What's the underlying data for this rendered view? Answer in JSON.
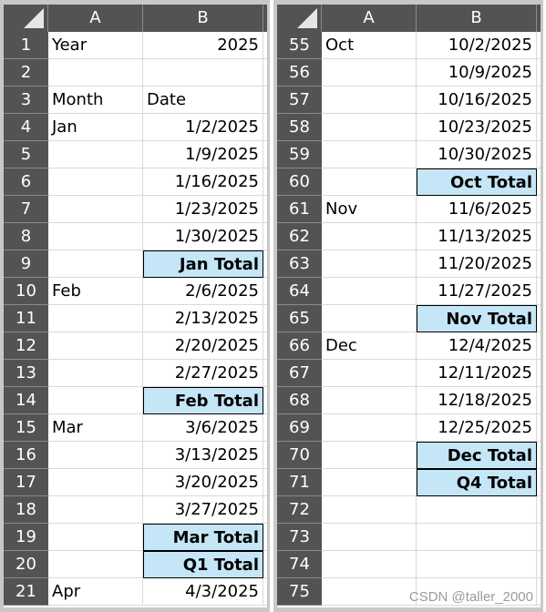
{
  "columns": [
    "A",
    "B"
  ],
  "colors": {
    "header_bg": "#535353",
    "total_fill": "#c5e6f6"
  },
  "left": [
    {
      "n": "1",
      "a": "Year",
      "b": "2025"
    },
    {
      "n": "2",
      "a": "",
      "b": ""
    },
    {
      "n": "3",
      "a": "Month",
      "b": "Date",
      "bl": true
    },
    {
      "n": "4",
      "a": "Jan",
      "b": "1/2/2025"
    },
    {
      "n": "5",
      "a": "",
      "b": "1/9/2025"
    },
    {
      "n": "6",
      "a": "",
      "b": "1/16/2025"
    },
    {
      "n": "7",
      "a": "",
      "b": "1/23/2025"
    },
    {
      "n": "8",
      "a": "",
      "b": "1/30/2025"
    },
    {
      "n": "9",
      "a": "",
      "b": "Jan Total",
      "t": true
    },
    {
      "n": "10",
      "a": "Feb",
      "b": "2/6/2025"
    },
    {
      "n": "11",
      "a": "",
      "b": "2/13/2025"
    },
    {
      "n": "12",
      "a": "",
      "b": "2/20/2025"
    },
    {
      "n": "13",
      "a": "",
      "b": "2/27/2025"
    },
    {
      "n": "14",
      "a": "",
      "b": "Feb Total",
      "t": true
    },
    {
      "n": "15",
      "a": "Mar",
      "b": "3/6/2025"
    },
    {
      "n": "16",
      "a": "",
      "b": "3/13/2025"
    },
    {
      "n": "17",
      "a": "",
      "b": "3/20/2025"
    },
    {
      "n": "18",
      "a": "",
      "b": "3/27/2025"
    },
    {
      "n": "19",
      "a": "",
      "b": "Mar Total",
      "t": true
    },
    {
      "n": "20",
      "a": "",
      "b": "Q1 Total",
      "t": true
    },
    {
      "n": "21",
      "a": "Apr",
      "b": "4/3/2025"
    }
  ],
  "right": [
    {
      "n": "55",
      "a": "Oct",
      "b": "10/2/2025"
    },
    {
      "n": "56",
      "a": "",
      "b": "10/9/2025"
    },
    {
      "n": "57",
      "a": "",
      "b": "10/16/2025"
    },
    {
      "n": "58",
      "a": "",
      "b": "10/23/2025"
    },
    {
      "n": "59",
      "a": "",
      "b": "10/30/2025"
    },
    {
      "n": "60",
      "a": "",
      "b": "Oct Total",
      "t": true
    },
    {
      "n": "61",
      "a": "Nov",
      "b": "11/6/2025"
    },
    {
      "n": "62",
      "a": "",
      "b": "11/13/2025"
    },
    {
      "n": "63",
      "a": "",
      "b": "11/20/2025"
    },
    {
      "n": "64",
      "a": "",
      "b": "11/27/2025"
    },
    {
      "n": "65",
      "a": "",
      "b": "Nov Total",
      "t": true
    },
    {
      "n": "66",
      "a": "Dec",
      "b": "12/4/2025"
    },
    {
      "n": "67",
      "a": "",
      "b": "12/11/2025"
    },
    {
      "n": "68",
      "a": "",
      "b": "12/18/2025"
    },
    {
      "n": "69",
      "a": "",
      "b": "12/25/2025"
    },
    {
      "n": "70",
      "a": "",
      "b": "Dec Total",
      "t": true
    },
    {
      "n": "71",
      "a": "",
      "b": "Q4 Total",
      "t": true
    },
    {
      "n": "72",
      "a": "",
      "b": ""
    },
    {
      "n": "73",
      "a": "",
      "b": ""
    },
    {
      "n": "74",
      "a": "",
      "b": ""
    },
    {
      "n": "75",
      "a": "",
      "b": ""
    }
  ],
  "watermark": "CSDN @taller_2000"
}
